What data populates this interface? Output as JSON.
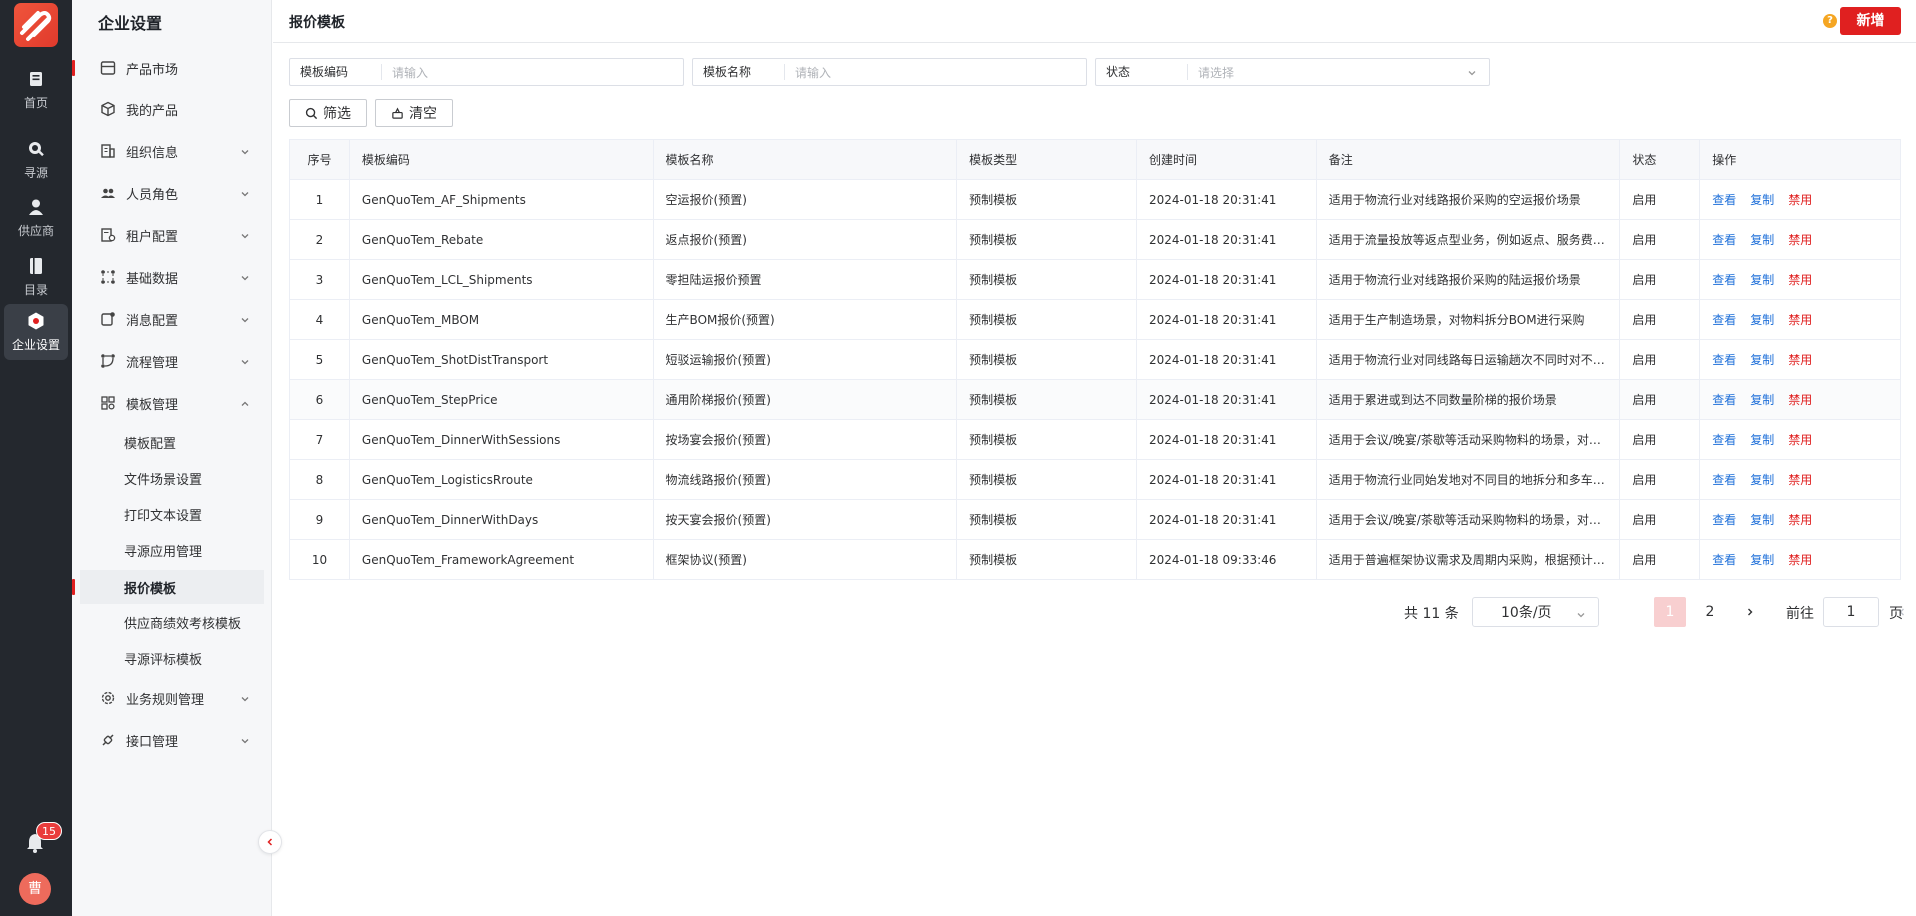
{
  "rail": {
    "items": [
      {
        "label": "首页"
      },
      {
        "label": "寻源"
      },
      {
        "label": "供应商"
      },
      {
        "label": "目录"
      },
      {
        "label": "企业设置"
      }
    ],
    "notification_count": "15",
    "avatar_text": "曹"
  },
  "sidebar": {
    "title": "企业设置",
    "items": [
      {
        "label": "产品市场"
      },
      {
        "label": "我的产品"
      },
      {
        "label": "组织信息"
      },
      {
        "label": "人员角色"
      },
      {
        "label": "租户配置"
      },
      {
        "label": "基础数据"
      },
      {
        "label": "消息配置"
      },
      {
        "label": "流程管理"
      },
      {
        "label": "模板管理"
      },
      {
        "label": "业务规则管理"
      },
      {
        "label": "接口管理"
      }
    ],
    "sub_items": [
      {
        "label": "模板配置"
      },
      {
        "label": "文件场景设置"
      },
      {
        "label": "打印文本设置"
      },
      {
        "label": "寻源应用管理"
      },
      {
        "label": "报价模板"
      },
      {
        "label": "供应商绩效考核模板"
      },
      {
        "label": "寻源评标模板"
      }
    ]
  },
  "header": {
    "title": "报价模板",
    "help": "?",
    "add_label": "新增"
  },
  "filters": [
    {
      "label": "模板编码",
      "placeholder": "请输入"
    },
    {
      "label": "模板名称",
      "placeholder": "请输入"
    },
    {
      "label": "状态",
      "placeholder": "请选择"
    }
  ],
  "buttons": {
    "filter_label": "筛选",
    "clear_label": "清空"
  },
  "table": {
    "columns": [
      "序号",
      "模板编码",
      "模板名称",
      "模板类型",
      "创建时间",
      "备注",
      "状态",
      "操作"
    ],
    "rows": [
      {
        "no": "1",
        "code": "GenQuoTem_AF_Shipments",
        "name": "空运报价(预置)",
        "type": "预制模板",
        "created": "2024-01-18 20:31:41",
        "remark": "适用于物流行业对线路报价采购的空运报价场景",
        "status": "启用"
      },
      {
        "no": "2",
        "code": "GenQuoTem_Rebate",
        "name": "返点报价(预置)",
        "type": "预制模板",
        "created": "2024-01-18 20:31:41",
        "remark": "适用于流量投放等返点型业务，例如返点、服务费…",
        "status": "启用"
      },
      {
        "no": "3",
        "code": "GenQuoTem_LCL_Shipments",
        "name": "零担陆运报价预置",
        "type": "预制模板",
        "created": "2024-01-18 20:31:41",
        "remark": "适用于物流行业对线路报价采购的陆运报价场景",
        "status": "启用"
      },
      {
        "no": "4",
        "code": "GenQuoTem_MBOM",
        "name": "生产BOM报价(预置)",
        "type": "预制模板",
        "created": "2024-01-18 20:31:41",
        "remark": "适用于生产制造场景，对物料拆分BOM进行采购",
        "status": "启用"
      },
      {
        "no": "5",
        "code": "GenQuoTem_ShotDistTransport",
        "name": "短驳运输报价(预置)",
        "type": "预制模板",
        "created": "2024-01-18 20:31:41",
        "remark": "适用于物流行业对同线路每日运输趟次不同时对不…",
        "status": "启用"
      },
      {
        "no": "6",
        "code": "GenQuoTem_StepPrice",
        "name": "通用阶梯报价(预置)",
        "type": "预制模板",
        "created": "2024-01-18 20:31:41",
        "remark": "适用于累进或到达不同数量阶梯的报价场景",
        "status": "启用"
      },
      {
        "no": "7",
        "code": "GenQuoTem_DinnerWithSessions",
        "name": "按场宴会报价(预置)",
        "type": "预制模板",
        "created": "2024-01-18 20:31:41",
        "remark": "适用于会议/晚宴/茶歇等活动采购物料的场景，对…",
        "status": "启用"
      },
      {
        "no": "8",
        "code": "GenQuoTem_LogisticsRroute",
        "name": "物流线路报价(预置)",
        "type": "预制模板",
        "created": "2024-01-18 20:31:41",
        "remark": "适用于物流行业同始发地对不同目的地拆分和多车…",
        "status": "启用"
      },
      {
        "no": "9",
        "code": "GenQuoTem_DinnerWithDays",
        "name": "按天宴会报价(预置)",
        "type": "预制模板",
        "created": "2024-01-18 20:31:41",
        "remark": "适用于会议/晚宴/茶歇等活动采购物料的场景，对…",
        "status": "启用"
      },
      {
        "no": "10",
        "code": "GenQuoTem_FrameworkAgreement",
        "name": "框架协议(预置)",
        "type": "预制模板",
        "created": "2024-01-18 09:33:46",
        "remark": "适用于普遍框架协议需求及周期内采购，根据预计…",
        "status": "启用"
      }
    ],
    "actions": {
      "view": "查看",
      "copy": "复制",
      "disable": "禁用"
    }
  },
  "pagination": {
    "total": "共 11 条",
    "page_size": "10条/页",
    "pages": [
      "1",
      "2"
    ],
    "current": "1",
    "goto_label": "前往",
    "goto_value": "1",
    "goto_unit": "页"
  },
  "colors": {
    "brand_red": "#e02020",
    "link_blue": "#1e6fd9",
    "rail_bg": "#24282e"
  }
}
